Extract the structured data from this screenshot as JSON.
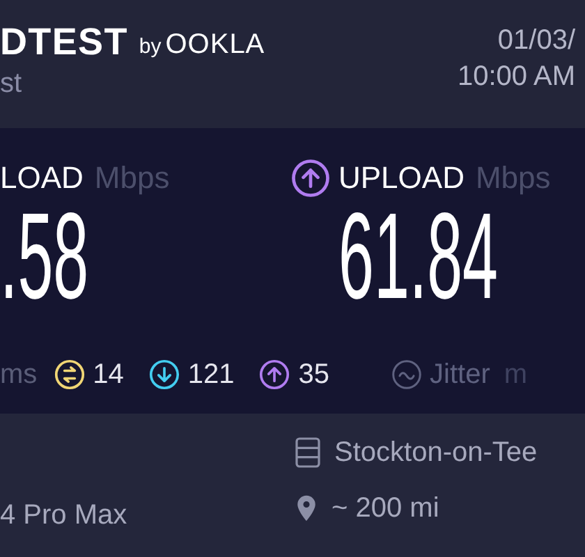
{
  "header": {
    "brand": "DTEST",
    "by": "by",
    "ookla": "OOKLA",
    "subtitle": "st",
    "date": "01/03/",
    "time": "10:00 AM"
  },
  "results": [
    {
      "kind": "download",
      "label": "LOAD",
      "unit": "Mbps",
      "value": ".58"
    },
    {
      "kind": "upload",
      "label": "UPLOAD",
      "unit": "Mbps",
      "value": "61.84"
    }
  ],
  "ping": {
    "unit": "ms",
    "items": [
      {
        "kind": "idle",
        "value": "14"
      },
      {
        "kind": "download",
        "value": "121"
      },
      {
        "kind": "upload",
        "value": "35"
      }
    ]
  },
  "jitter": {
    "label": "Jitter",
    "unit": "m"
  },
  "footer": {
    "device": "4 Pro Max",
    "server": "Stockton-on-Tee",
    "distance": "~ 200 mi"
  }
}
